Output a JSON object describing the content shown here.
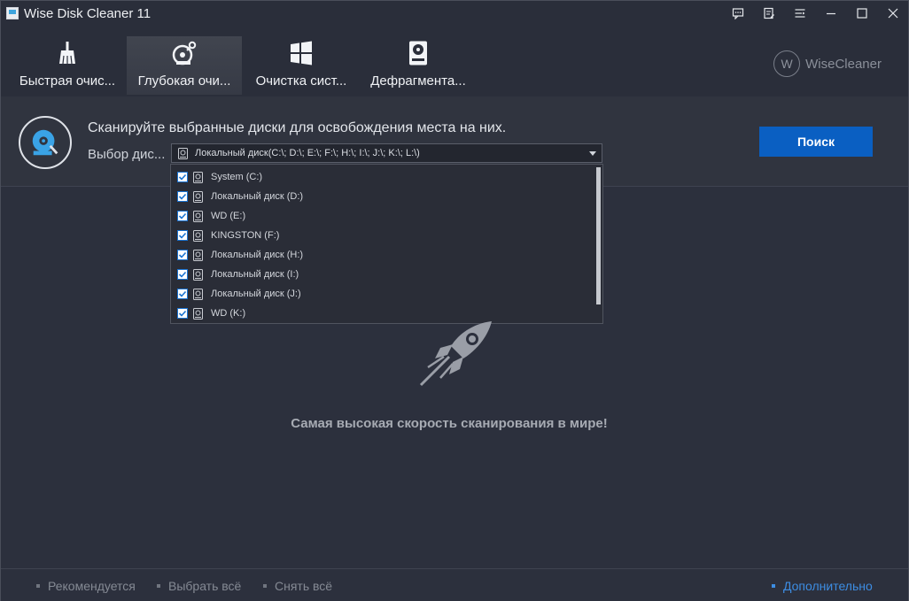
{
  "window": {
    "title": "Wise Disk Cleaner 11"
  },
  "titlebar_buttons": [
    "feedback-icon",
    "notes-icon",
    "menu-icon",
    "minimize-icon",
    "maximize-icon",
    "close-icon"
  ],
  "tabs": [
    {
      "label": "Быстрая очис...",
      "icon": "broom-icon",
      "active": false
    },
    {
      "label": "Глубокая очи...",
      "icon": "deep-scan-icon",
      "active": true
    },
    {
      "label": "Очистка сист...",
      "icon": "windows-icon",
      "active": false
    },
    {
      "label": "Дефрагмента...",
      "icon": "defrag-icon",
      "active": false
    }
  ],
  "brand": {
    "mark": "W",
    "name": "WiseCleaner"
  },
  "header": {
    "headline": "Сканируйте выбранные диски для освобождения места на них.",
    "select_label": "Выбор дис...",
    "combo_value": "Локальный диск(C:\\; D:\\; E:\\; F:\\; H:\\; I:\\; J:\\; K:\\; L:\\)",
    "search_button": "Поиск"
  },
  "drives": [
    {
      "label": "System (C:)",
      "checked": true
    },
    {
      "label": "Локальный диск (D:)",
      "checked": true
    },
    {
      "label": "WD (E:)",
      "checked": true
    },
    {
      "label": "KINGSTON (F:)",
      "checked": true
    },
    {
      "label": "Локальный диск (H:)",
      "checked": true
    },
    {
      "label": "Локальный диск (I:)",
      "checked": true
    },
    {
      "label": "Локальный диск (J:)",
      "checked": true
    },
    {
      "label": "WD (K:)",
      "checked": true
    }
  ],
  "main": {
    "tagline": "Самая высокая скорость сканирования в мире!"
  },
  "footer": {
    "recommended": "Рекомендуется",
    "select_all": "Выбрать всё",
    "deselect_all": "Снять всё",
    "more": "Дополнительно"
  },
  "colors": {
    "accent": "#0a5fc2",
    "link": "#3d8de3",
    "background": "#2c303d"
  }
}
